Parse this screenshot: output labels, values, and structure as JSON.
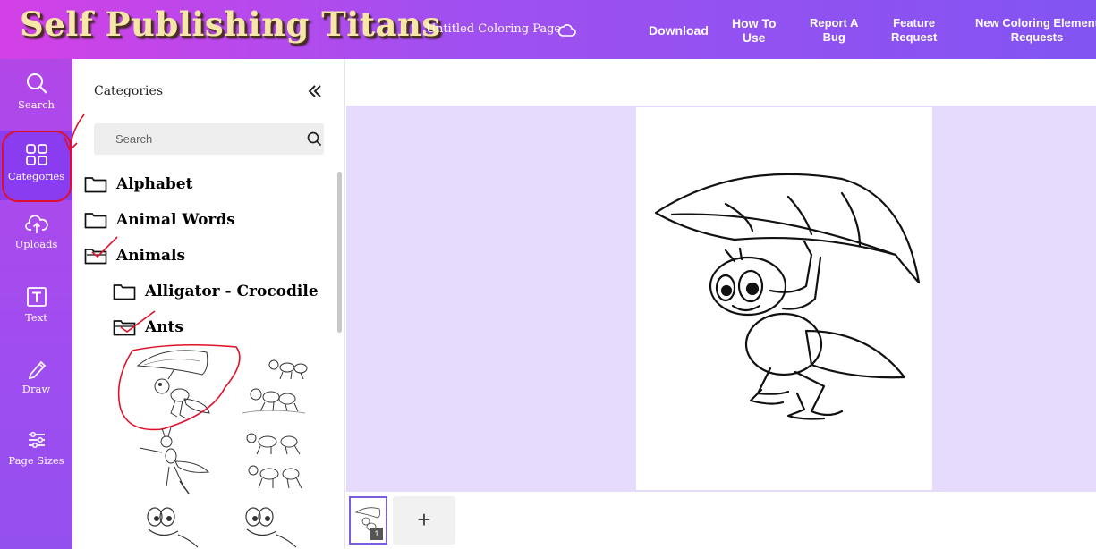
{
  "header": {
    "logo": "Self Publishing Titans",
    "document_title": "Untitled Coloring Page",
    "nav": {
      "download": "Download",
      "how_to_use_1": "How To",
      "how_to_use_2": "Use",
      "report_bug_1": "Report A",
      "report_bug_2": "Bug",
      "feature_1": "Feature",
      "feature_2": "Request",
      "new_element_1": "New Coloring Element",
      "new_element_2": "Requests"
    }
  },
  "rail": {
    "items": [
      {
        "label": "Search",
        "icon": "search-icon"
      },
      {
        "label": "Categories",
        "icon": "grid-icon"
      },
      {
        "label": "Uploads",
        "icon": "upload-cloud-icon"
      },
      {
        "label": "Text",
        "icon": "text-icon"
      },
      {
        "label": "Draw",
        "icon": "pencil-icon"
      },
      {
        "label": "Page Sizes",
        "icon": "sliders-icon"
      }
    ],
    "active": "Categories"
  },
  "panel": {
    "title": "Categories",
    "search_placeholder": "Search",
    "tree": [
      {
        "label": "Alphabet",
        "level": 0
      },
      {
        "label": "Animal Words",
        "level": 0
      },
      {
        "label": "Animals",
        "level": 0,
        "open": true
      },
      {
        "label": "Alligator - Crocodile",
        "level": 1
      },
      {
        "label": "Ants",
        "level": 1,
        "open": true
      }
    ],
    "thumbnails": [
      "ant-with-leaf",
      "ant-family",
      "ant-walking",
      "two-ants",
      "cartoon-ant-1",
      "cartoon-ant-2"
    ]
  },
  "pages": {
    "current_page_number": "1",
    "add_label": "+"
  },
  "colors": {
    "header_gradient_start": "#d341e6",
    "header_gradient_end": "#8254f2",
    "rail": "#a04df0",
    "canvas_bg": "#e7dbfd",
    "annotation": "#e0102a"
  }
}
